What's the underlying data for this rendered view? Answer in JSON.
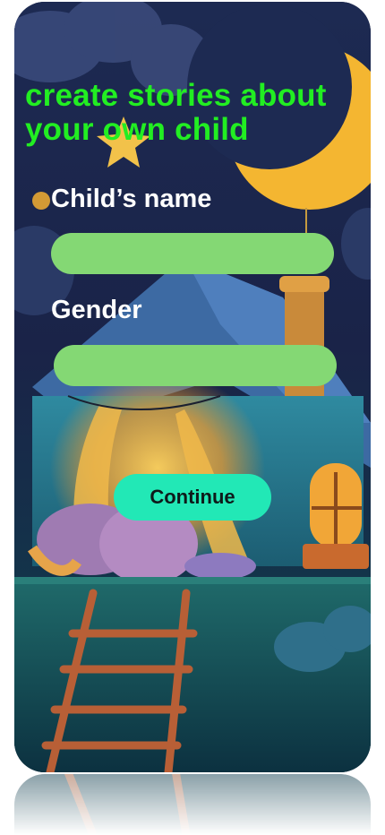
{
  "heading": "create stories about your own child",
  "form": {
    "name_label": "Child’s name",
    "name_value": "",
    "gender_label": "Gender",
    "gender_value": "",
    "continue_label": "Continue"
  },
  "colors": {
    "heading": "#22ee22",
    "field_fill": "#84d874",
    "button_fill": "#22e8b6",
    "label_text": "#ffffff"
  },
  "icons": [
    "crescent-moon-icon",
    "star-icon",
    "sparkle-icon"
  ]
}
